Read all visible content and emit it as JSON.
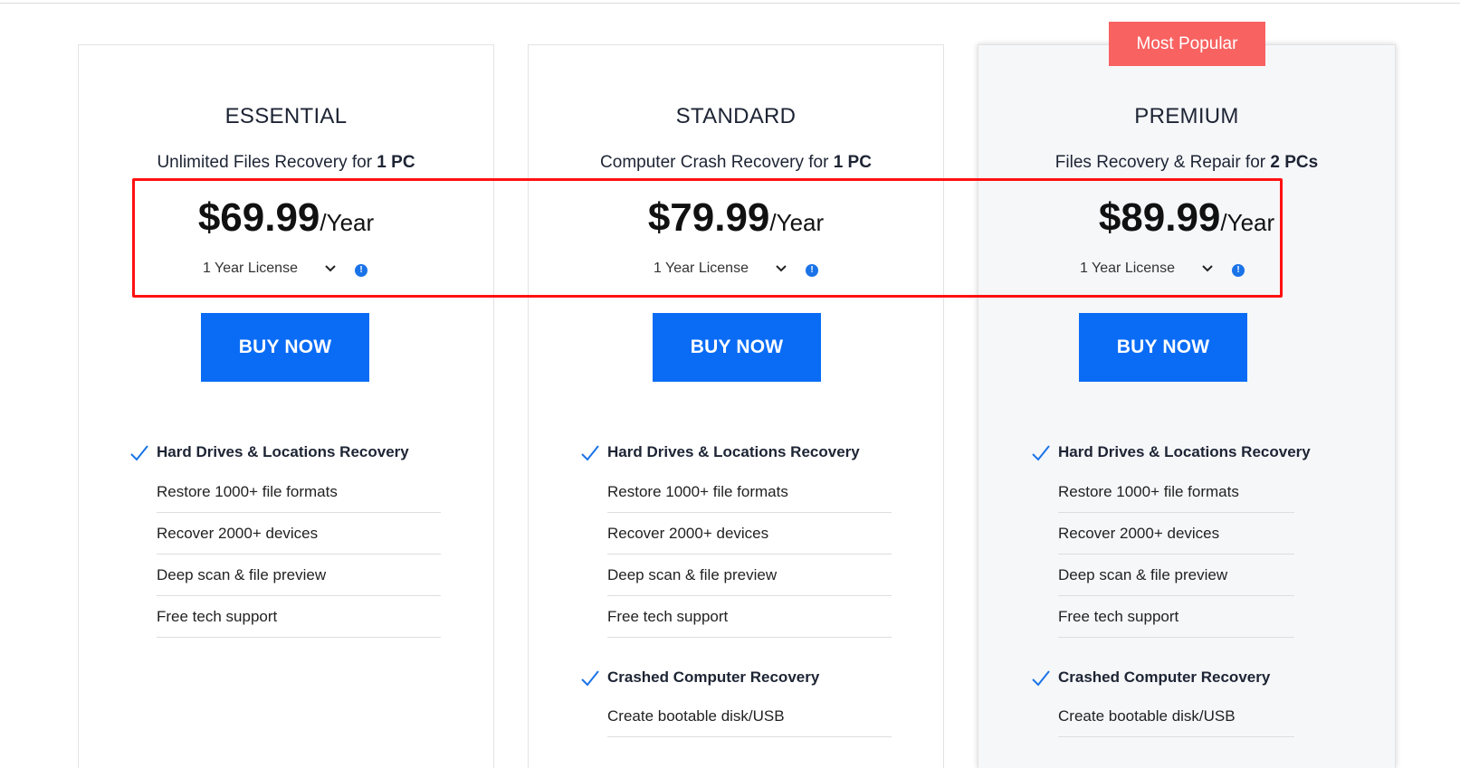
{
  "badge": "Most Popular",
  "plans": [
    {
      "title": "ESSENTIAL",
      "subtitle_text": "Unlimited Files Recovery for ",
      "subtitle_bold": "1 PC",
      "price": "$69.99",
      "period": "/Year",
      "license": "1 Year License",
      "buy_label": "BUY NOW",
      "sections": [
        {
          "heading": "Hard Drives & Locations Recovery",
          "items": [
            "Restore 1000+ file formats",
            "Recover 2000+ devices",
            "Deep scan & file preview",
            "Free tech support"
          ]
        }
      ]
    },
    {
      "title": "STANDARD",
      "subtitle_text": "Computer Crash Recovery for ",
      "subtitle_bold": "1 PC",
      "price": "$79.99",
      "period": "/Year",
      "license": "1 Year License",
      "buy_label": "BUY NOW",
      "sections": [
        {
          "heading": "Hard Drives & Locations Recovery",
          "items": [
            "Restore 1000+ file formats",
            "Recover 2000+ devices",
            "Deep scan & file preview",
            "Free tech support"
          ]
        },
        {
          "heading": "Crashed Computer Recovery",
          "items": [
            "Create bootable disk/USB"
          ]
        }
      ]
    },
    {
      "title": "PREMIUM",
      "subtitle_text": "Files Recovery & Repair for ",
      "subtitle_bold": "2 PCs",
      "price": "$89.99",
      "period": "/Year",
      "license": "1 Year License",
      "buy_label": "BUY NOW",
      "sections": [
        {
          "heading": "Hard Drives & Locations Recovery",
          "items": [
            "Restore 1000+ file formats",
            "Recover 2000+ devices",
            "Deep scan & file preview",
            "Free tech support"
          ]
        },
        {
          "heading": "Crashed Computer Recovery",
          "items": [
            "Create bootable disk/USB"
          ]
        }
      ]
    }
  ],
  "colors": {
    "buy_button": "#0a6cf5",
    "badge": "#f86261",
    "highlight_box": "#ff1111",
    "check": "#1a73e8"
  }
}
